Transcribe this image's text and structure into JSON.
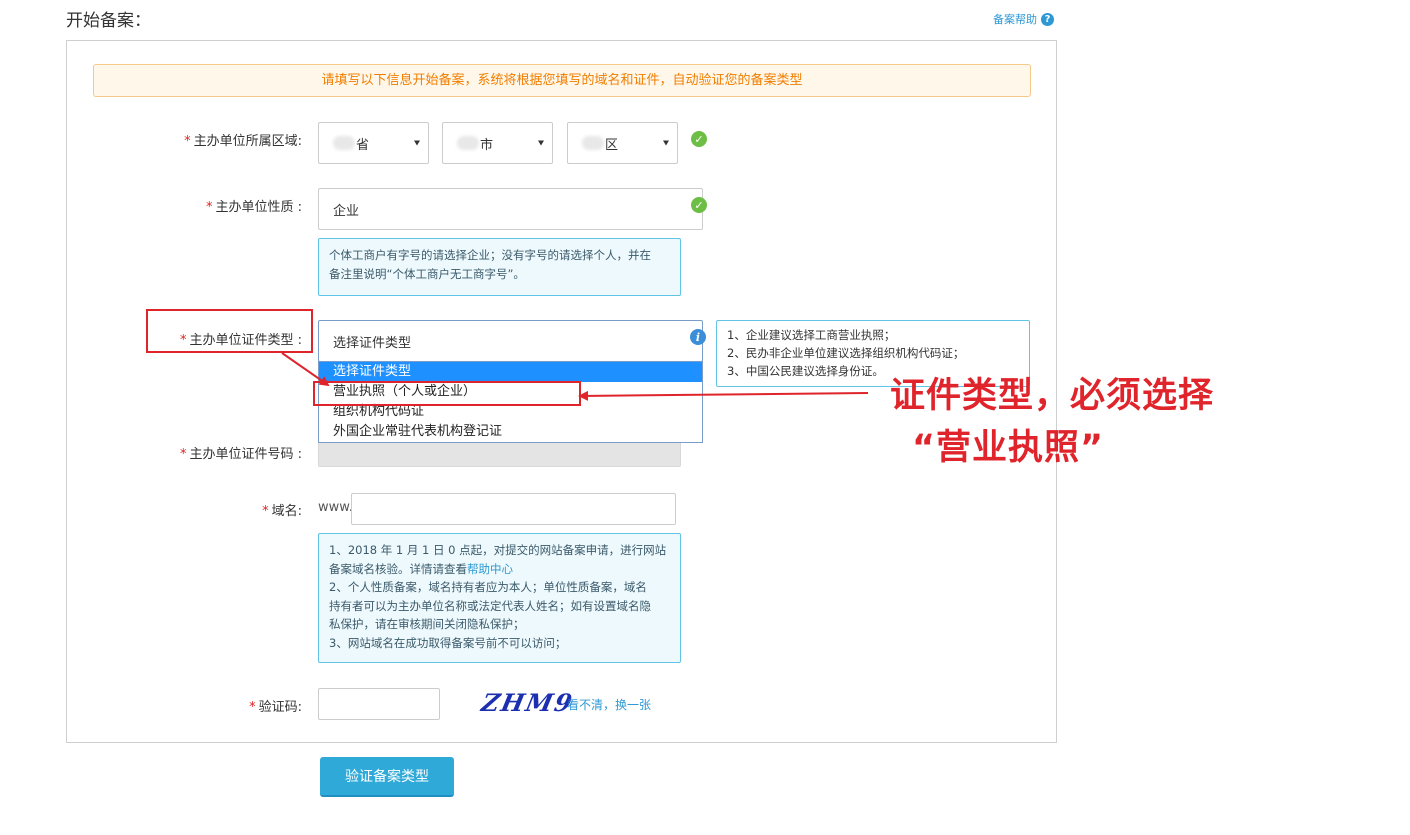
{
  "header": {
    "title": "开始备案：",
    "help_label": "备案帮助",
    "help_icon": "question-circle-icon"
  },
  "notice": "请填写以下信息开始备案，系统将根据您填写的域名和证件，自动验证您的备案类型",
  "region": {
    "label": "主办单位所属区域:",
    "province": "省",
    "city": "市",
    "district": "区"
  },
  "nature": {
    "label": "主办单位性质 :",
    "value": "企业",
    "tip": [
      "个体工商户有字号的请选择企业；没有字号的请选择个人，并在",
      "备注里说明“个体工商户无工商字号”。"
    ]
  },
  "cert_type": {
    "label": "主办单位证件类型 :",
    "selected": "选择证件类型",
    "options": [
      "选择证件类型",
      "营业执照（个人或企业）",
      "组织机构代码证",
      "外国企业常驻代表机构登记证"
    ],
    "tips": [
      "1、企业建议选择工商营业执照；",
      "2、民办非企业单位建议选择组织机构代码证；",
      "3、中国公民建议选择身份证。"
    ]
  },
  "cert_number": {
    "label": "主办单位证件号码 :"
  },
  "domain": {
    "label": "域名:",
    "prefix": "www.",
    "value": "",
    "tip_line1a": "1、2018 年 1 月 1 日 0 点起，对提交的网站备案申请，进行网站",
    "tip_line1b": "备案域名核验。详情请查看",
    "tip_link": "帮助中心",
    "tip_line2": "2、个人性质备案，域名持有者应为本人；单位性质备案，域名",
    "tip_line3": "持有者可以为主办单位名称或法定代表人姓名；如有设置域名隐",
    "tip_line4": "私保护，请在审核期间关闭隐私保护；",
    "tip_line5": "3、网站域名在成功取得备案号前不可以访问；"
  },
  "captcha": {
    "label": "验证码:",
    "image_text": "ZHM9",
    "refresh_label": "看不清，换一张"
  },
  "submit_label": "验证备案类型",
  "annotation": {
    "line1": "证件类型，必须选择",
    "line2": "“营业执照”",
    "color": "#e0242b"
  },
  "colors": {
    "accent": "#2fa9d8",
    "notice_text": "#f07d00",
    "ok": "#6dbe45",
    "highlight": "#1e90ff"
  }
}
